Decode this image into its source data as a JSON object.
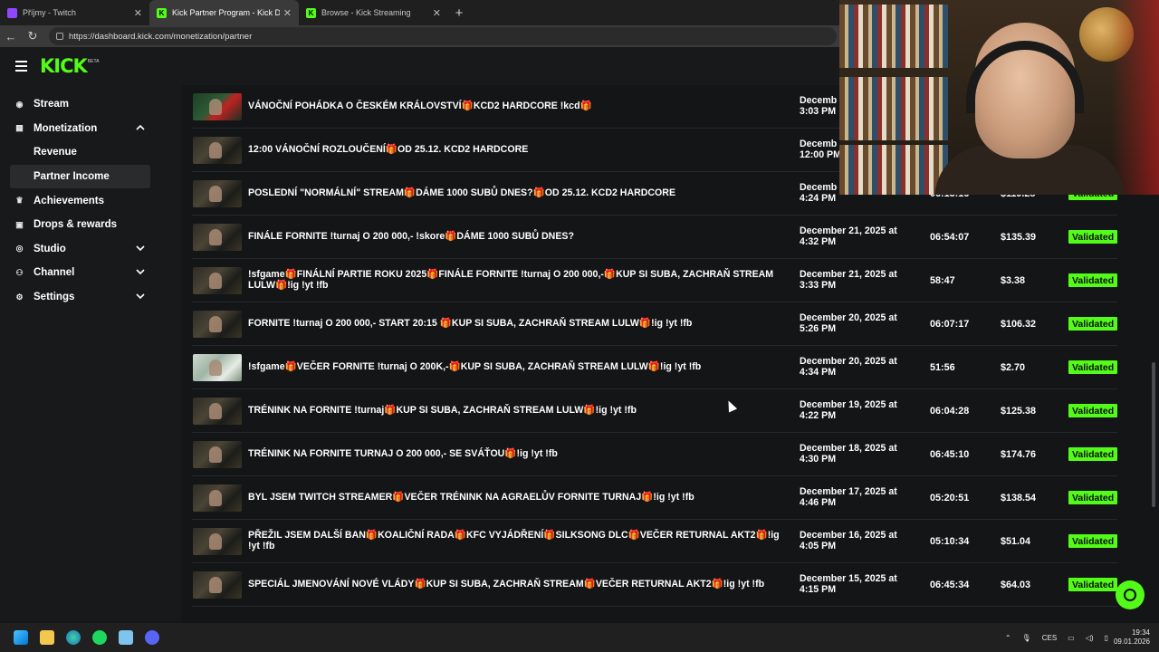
{
  "browser": {
    "tabs": [
      {
        "title": "Příjmy - Twitch",
        "icon": "twitch-icon",
        "color": "#9146ff",
        "active": false
      },
      {
        "title": "Kick Partner Program - Kick Dashb",
        "icon": "kick-icon",
        "color": "#53fc18",
        "active": true
      },
      {
        "title": "Browse - Kick Streaming",
        "icon": "kick-icon",
        "color": "#53fc18",
        "active": false
      }
    ],
    "url": "https://dashboard.kick.com/monetization/partner"
  },
  "header": {
    "logo": "KICK",
    "beta": "BETA"
  },
  "sidebar": {
    "items": [
      {
        "label": "Stream",
        "icon": "stream-icon",
        "glyph": "((•))"
      },
      {
        "label": "Monetization",
        "icon": "monetization-icon",
        "glyph": "▦",
        "expanded": true
      },
      {
        "label": "Achievements",
        "icon": "trophy-icon",
        "glyph": "🏆"
      },
      {
        "label": "Drops & rewards",
        "icon": "gift-icon",
        "glyph": "▣"
      },
      {
        "label": "Studio",
        "icon": "studio-icon",
        "glyph": "◉"
      },
      {
        "label": "Channel",
        "icon": "channel-icon",
        "glyph": "⚇"
      },
      {
        "label": "Settings",
        "icon": "gear-icon",
        "glyph": "⚙"
      }
    ],
    "sub_items": [
      {
        "label": "Revenue"
      },
      {
        "label": "Partner Income",
        "active": true
      }
    ]
  },
  "rows": [
    {
      "title": "VÁNOČNÍ POHÁDKA O ČESKÉM KRÁLOVSTVÍ🎁KCD2 HARDCORE !kcd🎁",
      "date": "December 2, 3:03 PM",
      "date_l1": "Decemb",
      "date_l2": "3:03 PM",
      "duration": "",
      "amount": "",
      "status": ""
    },
    {
      "title": "12:00 VÁNOČNÍ ROZLOUČENÍ🎁OD 25.12. KCD2 HARDCORE",
      "date_l1": "Decemb",
      "date_l2": "12:00 PM",
      "duration": "",
      "amount": "",
      "status": ""
    },
    {
      "title": "POSLEDNÍ \"NORMÁLNÍ\" STREAM🎁DÁME 1000 SUBŮ DNES?🎁OD 25.12. KCD2 HARDCORE",
      "date_l1": "Decemb",
      "date_l2": "4:24 PM",
      "duration": "06:13:16",
      "amount": "$119.28",
      "status": "Validated"
    },
    {
      "title": "FINÁLE FORNITE !turnaj O 200 000,- !skore🎁DÁME 1000 SUBŮ DNES?",
      "date_l1": "December 21, 2025 at",
      "date_l2": "4:32 PM",
      "duration": "06:54:07",
      "amount": "$135.39",
      "status": "Validated"
    },
    {
      "title": "!sfgame🎁FINÁLNÍ PARTIE ROKU 2025🎁FINÁLE FORNITE !turnaj O 200 000,-🎁KUP SI SUBA, ZACHRAŇ STREAM LULW🎁!ig !yt !fb",
      "date_l1": "December 21, 2025 at",
      "date_l2": "3:33 PM",
      "duration": "58:47",
      "amount": "$3.38",
      "status": "Validated"
    },
    {
      "title": "FORNITE !turnaj O 200 000,- START 20:15 🎁KUP SI SUBA, ZACHRAŇ STREAM LULW🎁!ig !yt !fb",
      "date_l1": "December 20, 2025 at",
      "date_l2": "5:26 PM",
      "duration": "06:07:17",
      "amount": "$106.32",
      "status": "Validated"
    },
    {
      "title": "!sfgame🎁VEČER FORNITE !turnaj O 200K,-🎁KUP SI SUBA, ZACHRAŇ STREAM LULW🎁!ig !yt !fb",
      "date_l1": "December 20, 2025 at",
      "date_l2": "4:34 PM",
      "duration": "51:56",
      "amount": "$2.70",
      "status": "Validated"
    },
    {
      "title": "TRÉNINK NA FORNITE !turnaj🎁KUP SI SUBA, ZACHRAŇ STREAM LULW🎁!ig !yt !fb",
      "date_l1": "December 19, 2025 at",
      "date_l2": "4:22 PM",
      "duration": "06:04:28",
      "amount": "$125.38",
      "status": "Validated"
    },
    {
      "title": "TRÉNINK NA FORNITE TURNAJ O 200 000,- SE SVÁŤOU🎁!ig !yt !fb",
      "date_l1": "December 18, 2025 at",
      "date_l2": "4:30 PM",
      "duration": "06:45:10",
      "amount": "$174.76",
      "status": "Validated"
    },
    {
      "title": "BYL JSEM TWITCH STREAMER🎁VEČER TRÉNINK NA AGRAELŮV FORNITE TURNAJ🎁!ig !yt !fb",
      "date_l1": "December 17, 2025 at",
      "date_l2": "4:46 PM",
      "duration": "05:20:51",
      "amount": "$138.54",
      "status": "Validated"
    },
    {
      "title": "PŘEŽIL JSEM DALŠÍ BAN🎁KOALIČNÍ RADA🎁KFC VYJÁDŘENÍ🎁SILKSONG DLC🎁VEČER RETURNAL AKT2🎁!ig !yt !fb",
      "date_l1": "December 16, 2025 at",
      "date_l2": "4:05 PM",
      "duration": "05:10:34",
      "amount": "$51.04",
      "status": "Validated"
    },
    {
      "title": "SPECIÁL JMENOVÁNÍ NOVÉ VLÁDY🎁KUP SI SUBA, ZACHRAŇ STREAM🎁VEČER RETURNAL AKT2🎁!ig !yt !fb",
      "date_l1": "December 15, 2025 at",
      "date_l2": "4:15 PM",
      "duration": "06:45:34",
      "amount": "$64.03",
      "status": "Validated"
    }
  ],
  "taskbar": {
    "language": "CES",
    "time": "19:34",
    "date": "09.01.2026"
  },
  "colors": {
    "accent": "#53fc18",
    "background": "#141517",
    "sidebar": "#18191b"
  }
}
